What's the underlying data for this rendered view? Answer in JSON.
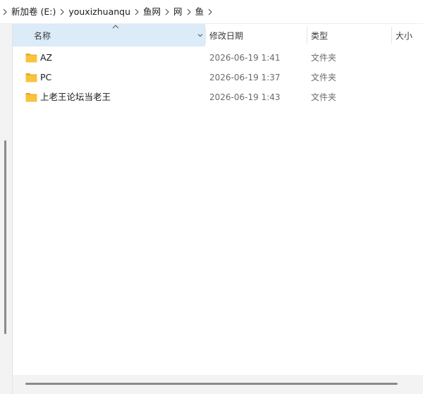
{
  "breadcrumb": {
    "items": [
      "新加卷 (E:)",
      "youxizhuanqu",
      "鱼网",
      "网",
      "鱼"
    ]
  },
  "columns": {
    "name": "名称",
    "date_modified": "修改日期",
    "type": "类型",
    "size": "大小"
  },
  "files": [
    {
      "name": "AZ",
      "date_modified": "2026-06-19 1:41",
      "type": "文件夹"
    },
    {
      "name": "PC",
      "date_modified": "2026-06-19 1:37",
      "type": "文件夹"
    },
    {
      "name": "上老王论坛当老王",
      "date_modified": "2026-06-19 1:43",
      "type": "文件夹"
    }
  ],
  "icons": {
    "breadcrumb_separator": "chevron-right-icon",
    "folder": "folder-icon",
    "sort": "sort-ascending-icon",
    "column_menu": "chevron-down-icon"
  },
  "colors": {
    "header_selected": "#dcebf8",
    "folder_body": "#f8c33d",
    "folder_tab": "#e8a623",
    "secondary_text": "#6b6b6b"
  }
}
